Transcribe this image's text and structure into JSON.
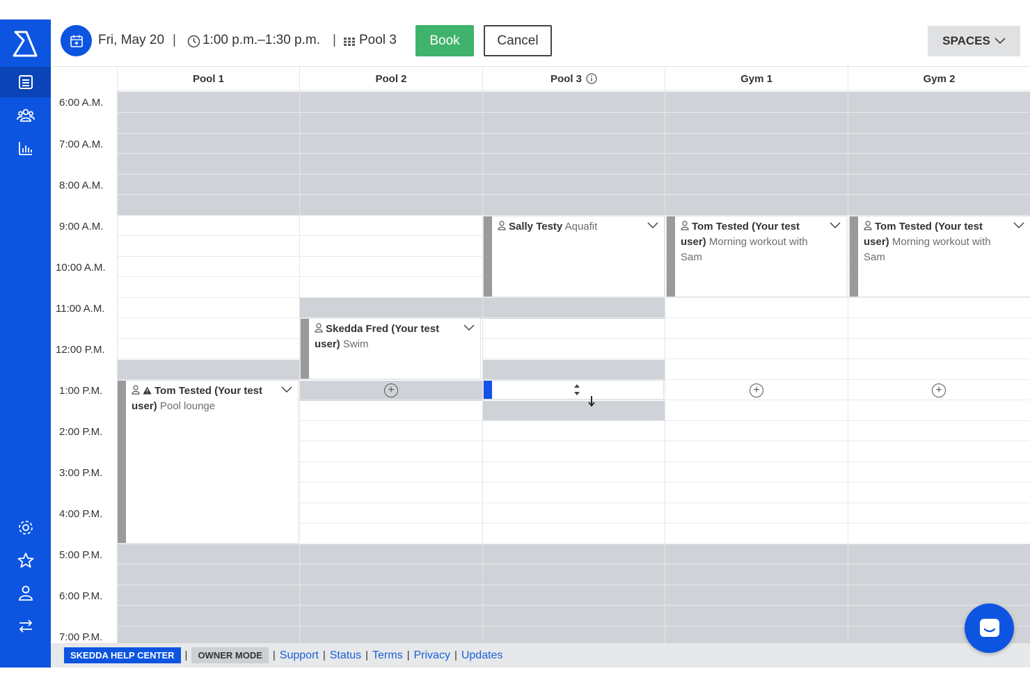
{
  "header": {
    "date": "Fri, May 20",
    "time_range": "1:00 p.m.–1:30 p.m.",
    "space": "Pool 3",
    "book_label": "Book",
    "cancel_label": "Cancel",
    "spaces_label": "SPACES"
  },
  "columns": [
    "Pool 1",
    "Pool 2",
    "Pool 3",
    "Gym 1",
    "Gym 2"
  ],
  "times": [
    "6:00 A.M.",
    "7:00 A.M.",
    "8:00 A.M.",
    "9:00 A.M.",
    "10:00 A.M.",
    "11:00 A.M.",
    "12:00 P.M.",
    "1:00 P.M.",
    "2:00 P.M.",
    "3:00 P.M.",
    "4:00 P.M.",
    "5:00 P.M.",
    "6:00 P.M.",
    "7:00 P.M."
  ],
  "bookings": {
    "pool3": {
      "name": "Sally Testy",
      "desc": "Aquafit"
    },
    "gym1": {
      "name": "Tom Tested (Your test user)",
      "desc": "Morning workout with Sam"
    },
    "gym2": {
      "name": "Tom Tested (Your test user)",
      "desc": "Morning workout with Sam"
    },
    "pool2": {
      "name": "Skedda Fred (Your test user)",
      "desc": "Swim"
    },
    "pool1": {
      "name": "Tom Tested (Your test user)",
      "desc": "Pool lounge"
    }
  },
  "footer": {
    "help_center": "SKEDDA HELP CENTER",
    "owner_mode": "OWNER MODE",
    "links": [
      "Support",
      "Status",
      "Terms",
      "Privacy",
      "Updates"
    ]
  },
  "colors": {
    "brand": "#0d55e0",
    "book": "#3fb36b",
    "closed": "#cfd3d7"
  }
}
